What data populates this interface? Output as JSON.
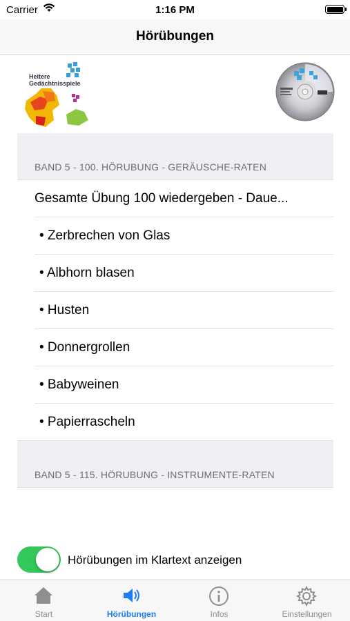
{
  "status_bar": {
    "carrier": "Carrier",
    "time": "1:16 PM"
  },
  "nav": {
    "title": "Hörübungen"
  },
  "header_logo": {
    "text_line1": "Heitere",
    "text_line2": "Gedächtnisspiele"
  },
  "sections": [
    {
      "header": "BAND 5 - 100. HÖRUBUNG - GERÄUSCHE-RATEN",
      "play_all": "Gesamte Übung 100 wiedergeben - Daue...",
      "items": [
        "• Zerbrechen von Glas",
        "• Albhorn blasen",
        "• Husten",
        "• Donnergrollen",
        "• Babyweinen",
        "• Papierrascheln"
      ]
    },
    {
      "header": "BAND 5 - 115. HÖRUBUNG - INSTRUMENTE-RATEN"
    }
  ],
  "toggle": {
    "label": "Hörübungen im Klartext anzeigen",
    "on": true,
    "color": "#34c759"
  },
  "tabs": [
    {
      "label": "Start",
      "icon": "house-icon"
    },
    {
      "label": "Hörübungen",
      "icon": "speaker-icon",
      "active": true
    },
    {
      "label": "Infos",
      "icon": "info-icon"
    },
    {
      "label": "Einstellungen",
      "icon": "gear-icon"
    }
  ],
  "colors": {
    "accent": "#1e7cf2",
    "inactive": "#8e8e93"
  }
}
